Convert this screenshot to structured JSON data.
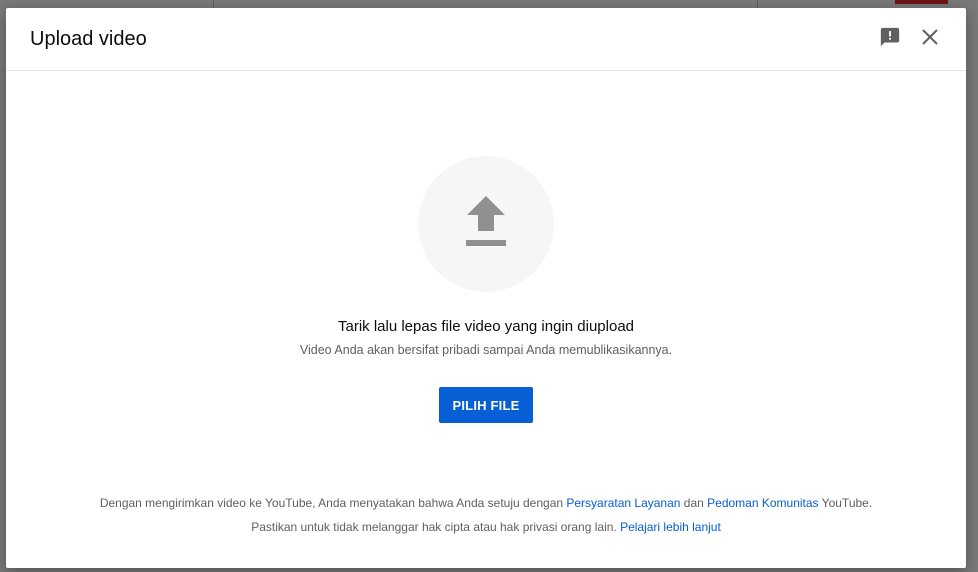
{
  "dialog": {
    "title": "Upload video",
    "icons": {
      "feedback": "feedback-icon",
      "close": "close-icon",
      "upload": "upload-arrow-icon"
    }
  },
  "dropzone": {
    "title": "Tarik lalu lepas file video yang ingin diupload",
    "subtitle": "Video Anda akan bersifat pribadi sampai Anda memublikasikannya.",
    "button_label": "PILIH FILE"
  },
  "footer": {
    "line1": {
      "prefix": "Dengan mengirimkan video ke YouTube, Anda menyatakan bahwa Anda setuju dengan ",
      "terms_link": "Persyaratan Layanan",
      "middle": " dan ",
      "guidelines_link": "Pedoman Komunitas",
      "suffix": " YouTube."
    },
    "line2": {
      "prefix": "Pastikan untuk tidak melanggar hak cipta atau hak privasi orang lain. ",
      "learn_more_link": "Pelajari lebih lanjut"
    }
  },
  "colors": {
    "accent": "#065fd4",
    "overlay": "#7a7a7a",
    "icon_gray": "#909090"
  }
}
